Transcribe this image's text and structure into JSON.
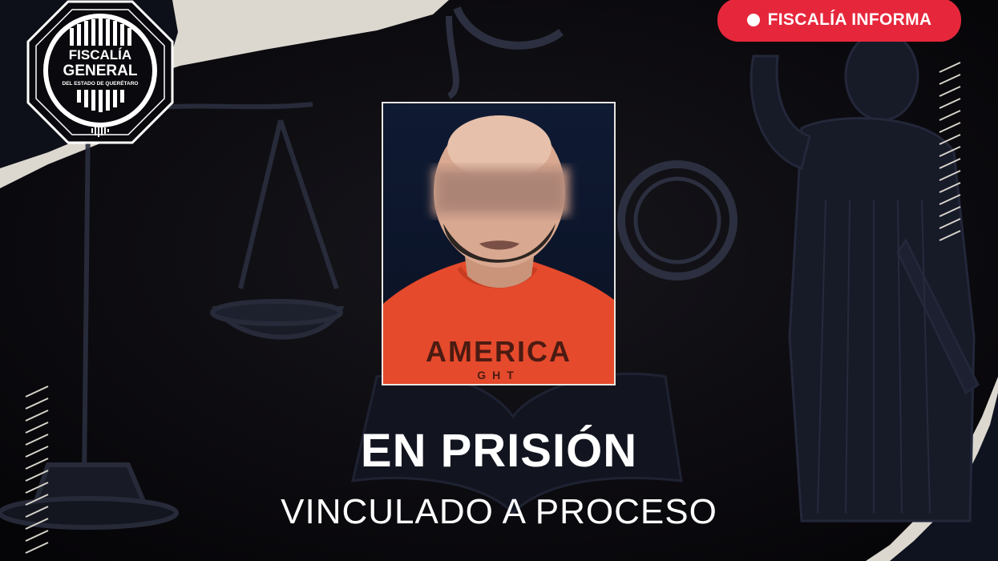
{
  "badge": {
    "label": "FISCALÍA INFORMA",
    "color": "#e6273b"
  },
  "logo": {
    "line1": "FISCALÍA",
    "line2": "GENERAL",
    "line3": "DEL ESTADO DE QUERÉTARO"
  },
  "photo": {
    "shirt_text_1": "AMERICA",
    "shirt_text_2": "GHT"
  },
  "headline": "EN PRISIÓN",
  "subheadline": "VINCULADO A PROCESO"
}
